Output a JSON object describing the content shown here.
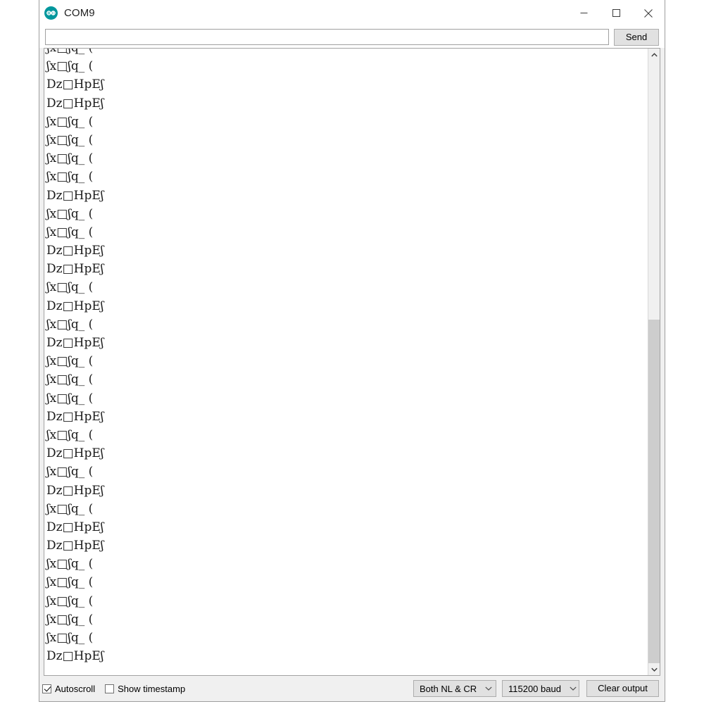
{
  "window": {
    "title": "COM9",
    "app_icon": "arduino-infinity-icon",
    "accent_color": "#00979d",
    "controls": {
      "minimize": "minimize-icon",
      "maximize": "maximize-icon",
      "close": "close-icon"
    }
  },
  "send_bar": {
    "input_value": "",
    "input_placeholder": "",
    "send_label": "Send"
  },
  "output": {
    "line_a": "ʃx□ʃq_ (",
    "line_b": "Dz□HpEʃ",
    "partial_top_line": "ʃx□ʃq_ (",
    "lines": [
      "ʃx□ʃq_ (",
      "Dz□HpEʃ",
      "Dz□HpEʃ",
      "ʃx□ʃq_ (",
      "ʃx□ʃq_ (",
      "ʃx□ʃq_ (",
      "ʃx□ʃq_ (",
      "Dz□HpEʃ",
      "ʃx□ʃq_ (",
      "ʃx□ʃq_ (",
      "Dz□HpEʃ",
      "Dz□HpEʃ",
      "ʃx□ʃq_ (",
      "Dz□HpEʃ",
      "ʃx□ʃq_ (",
      "Dz□HpEʃ",
      "ʃx□ʃq_ (",
      "ʃx□ʃq_ (",
      "ʃx□ʃq_ (",
      "Dz□HpEʃ",
      "ʃx□ʃq_ (",
      "Dz□HpEʃ",
      "ʃx□ʃq_ (",
      "Dz□HpEʃ",
      "ʃx□ʃq_ (",
      "Dz□HpEʃ",
      "Dz□HpEʃ",
      "ʃx□ʃq_ (",
      "ʃx□ʃq_ (",
      "ʃx□ʃq_ (",
      "ʃx□ʃq_ (",
      "ʃx□ʃq_ (",
      "Dz□HpEʃ"
    ]
  },
  "scrollbar": {
    "up_arrow": "chevron-up-icon",
    "down_arrow": "chevron-down-icon",
    "thumb_top_percent": 43,
    "thumb_height_percent": 57,
    "track_color": "#f0f0f0",
    "thumb_color": "#cdcdcd"
  },
  "status_bar": {
    "autoscroll_label": "Autoscroll",
    "autoscroll_checked": true,
    "timestamp_label": "Show timestamp",
    "timestamp_checked": false,
    "line_ending": "Both NL & CR",
    "baud_rate": "115200 baud",
    "clear_output_label": "Clear output"
  }
}
